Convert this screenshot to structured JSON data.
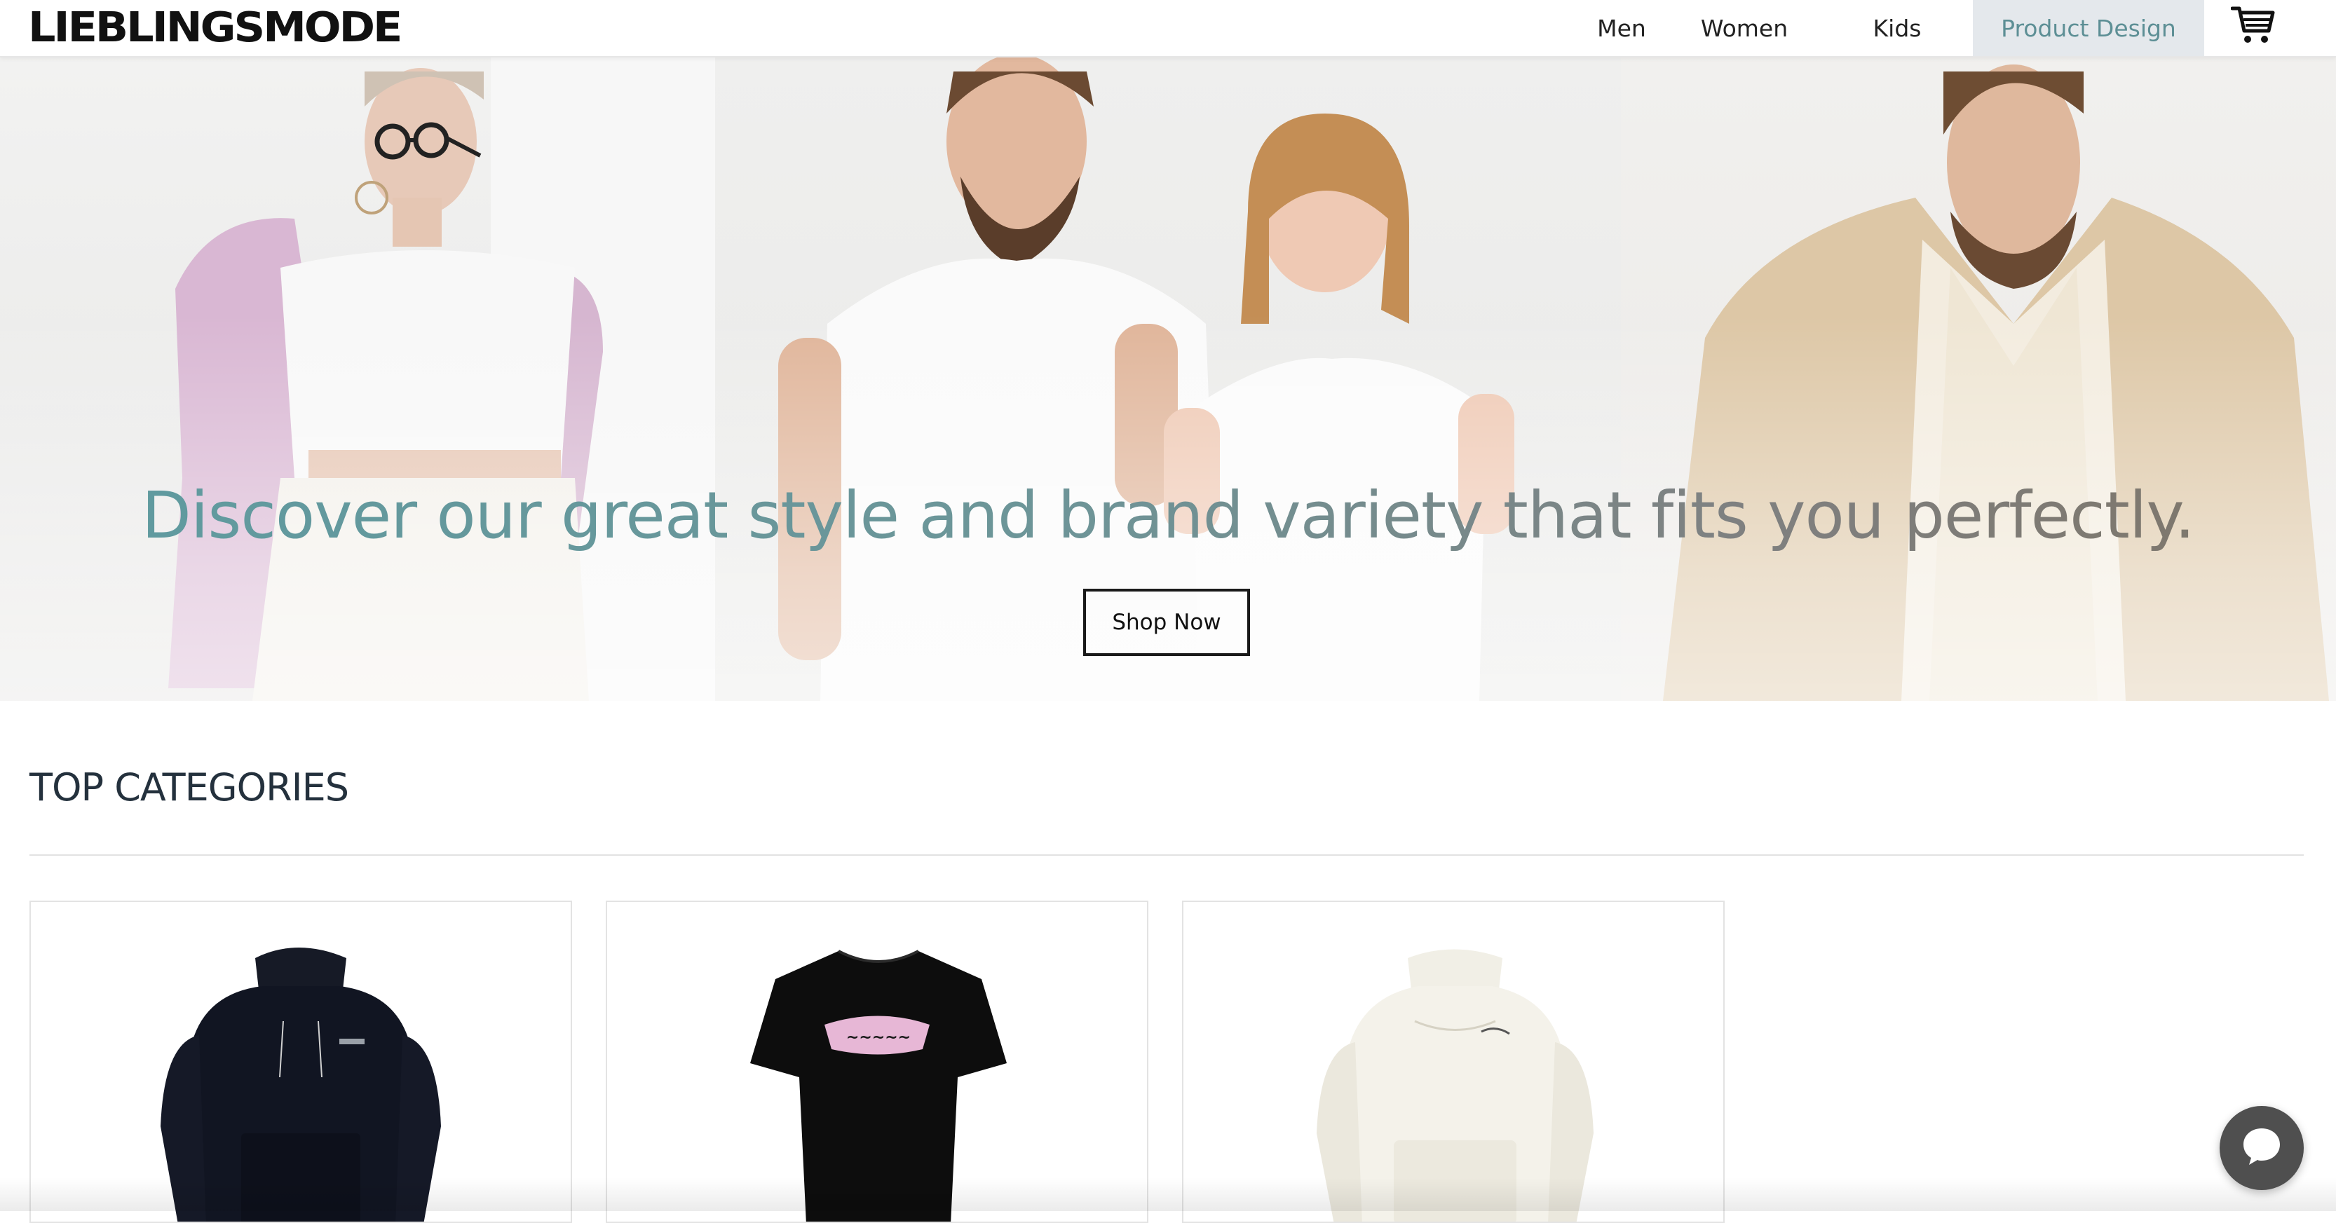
{
  "header": {
    "logo_text": "LIEBLINGSMODE",
    "nav": {
      "men": "Men",
      "women": "Women",
      "kids": "Kids",
      "product_design": "Product Design"
    },
    "cart_icon": "shopping-cart-icon"
  },
  "hero": {
    "headline": "Discover our great style and brand variety that fits you perfectly.",
    "cta_label": "Shop Now"
  },
  "categories": {
    "title": "TOP CATEGORIES",
    "items": [
      {
        "image": "black-hoodie"
      },
      {
        "image": "black-t-shirt-with-print"
      },
      {
        "image": "cream-hoodie"
      }
    ]
  },
  "chat": {
    "icon": "chat-bubble-icon"
  },
  "colors": {
    "accent": "#5e9ba0",
    "active_nav_bg": "#e4e8ec",
    "text_dark": "#24313d"
  }
}
